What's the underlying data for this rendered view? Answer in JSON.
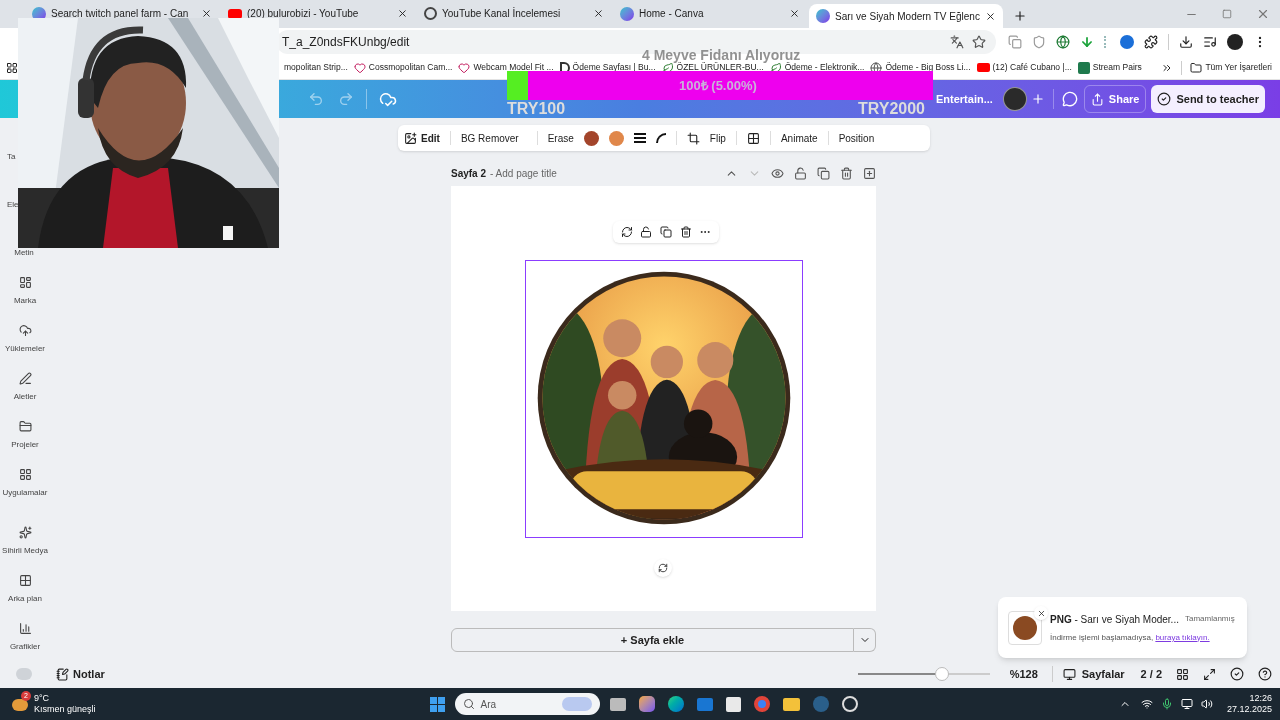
{
  "browser": {
    "tabs": [
      {
        "title": "Search twitch panel farm - Can",
        "selected": false
      },
      {
        "title": "(20) bulurobizi - YouTube",
        "selected": false
      },
      {
        "title": "YouTube Kanal İncelemesi",
        "selected": false
      },
      {
        "title": "Home - Canva",
        "selected": false
      },
      {
        "title": "Sarı ve Siyah Modern TV Eğlenc",
        "selected": true
      }
    ],
    "url": "T_a_Z0ndsFKUnbg/edit",
    "bookmarks": [
      "mopolitan Strip...",
      "Cossmopolitan Cam...",
      "Webcam Model Fit ...",
      "Ödeme Sayfası | Bu...",
      "ÖZEL ÜRÜNLER-BU...",
      "Ödeme - Elektronik...",
      "Ödeme - Big Boss Li...",
      "(12) Café Cubano |...",
      "Stream Pairs"
    ],
    "all_bookmarks": "Tüm Yer İşaretleri"
  },
  "canva": {
    "design_title": "Entertain...",
    "share": "Share",
    "send": "Send to teacher",
    "sidebar": [
      {
        "label": "Ta",
        "kind": "partial"
      },
      {
        "label": "Ele",
        "kind": "partial"
      },
      {
        "label": "Metin",
        "kind": "covered"
      },
      {
        "label": "Marka",
        "kind": "item"
      },
      {
        "label": "Yüklemeler",
        "kind": "item"
      },
      {
        "label": "Aletler",
        "kind": "item"
      },
      {
        "label": "Projeler",
        "kind": "item"
      },
      {
        "label": "Uygulamalar",
        "kind": "item"
      },
      {
        "label": "Sihirli Medya",
        "kind": "item"
      },
      {
        "label": "Arka plan",
        "kind": "item"
      },
      {
        "label": "Grafikler",
        "kind": "item"
      }
    ],
    "toolbar": {
      "edit": "Edit",
      "bg_remover": "BG Remover",
      "erase": "Erase",
      "colors": [
        {
          "color": "#a3452b"
        },
        {
          "color": "#e0874a"
        }
      ],
      "flip": "Flip",
      "animate": "Animate",
      "position": "Position"
    },
    "page": {
      "name": "Sayfa 2",
      "title_placeholder": "- Add page title"
    },
    "add_page": "+ Sayfa ekle",
    "notes": "Notlar",
    "zoom": {
      "level": 0.64,
      "reading": "%128"
    },
    "pages_label": "Sayfalar",
    "page_count": "2 / 2",
    "download": {
      "format": "PNG",
      "name": " - Sarı ve Siyah Moder...",
      "status": "Tamamlanmış",
      "message": "İndirme işlemi başlamadıysa, ",
      "link": "buraya tıklayın."
    }
  },
  "stream_overlay": {
    "goal_title": "4 Meyve Fidanı Alıyoruz",
    "goal": {
      "level": 0.05,
      "reading": "100₺ (5.00%)"
    },
    "min": "TRY100",
    "max": "TRY2000"
  },
  "taskbar": {
    "weather_badge": "2",
    "temperature": "9°C",
    "weather": "Kısmen güneşli",
    "search": "Ara",
    "time": "12:26",
    "date": "27.12.2025"
  }
}
